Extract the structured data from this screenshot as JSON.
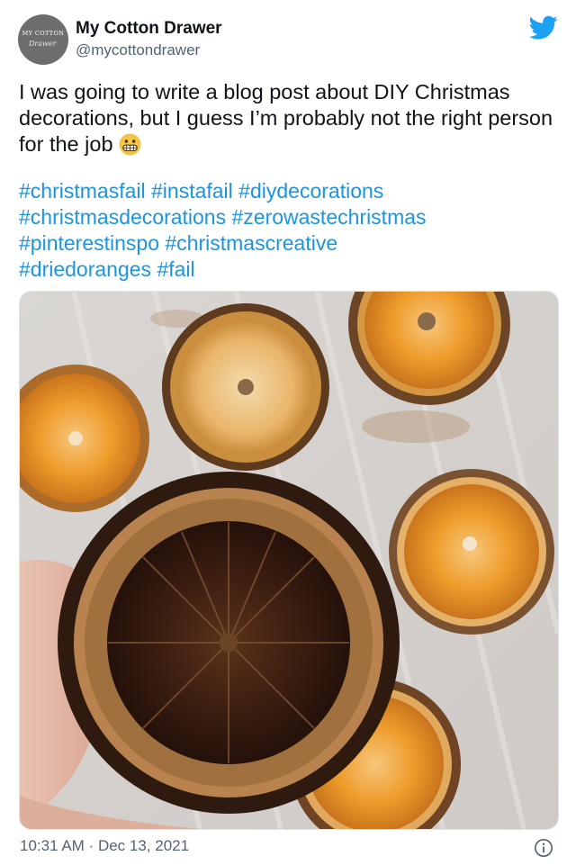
{
  "author": {
    "display_name": "My Cotton Drawer",
    "handle": "@mycottondrawer",
    "avatar_text": "MY COTTON",
    "avatar_script": "Drawer"
  },
  "tweet": {
    "text": "I was going to write a blog post about DIY Christmas decorations, but I guess I’m probably not the right person for the job",
    "emoji_icon": "grimacing-face-icon",
    "hashtags": [
      "#christmasfail",
      "#instafail",
      "#diydecorations",
      "#christmasdecorations",
      "#zerowastechristmas",
      "#pinterestinspo",
      "#christmascreative",
      "#driedoranges",
      "#fail"
    ]
  },
  "footer": {
    "time": "10:31 AM",
    "separator": " · ",
    "date": "Dec 13, 2021"
  },
  "icons": {
    "brand": "twitter-bird-icon",
    "info": "info-icon"
  },
  "colors": {
    "link": "#1b95e0",
    "brand": "#1da1f2",
    "secondary_text": "#536471"
  }
}
